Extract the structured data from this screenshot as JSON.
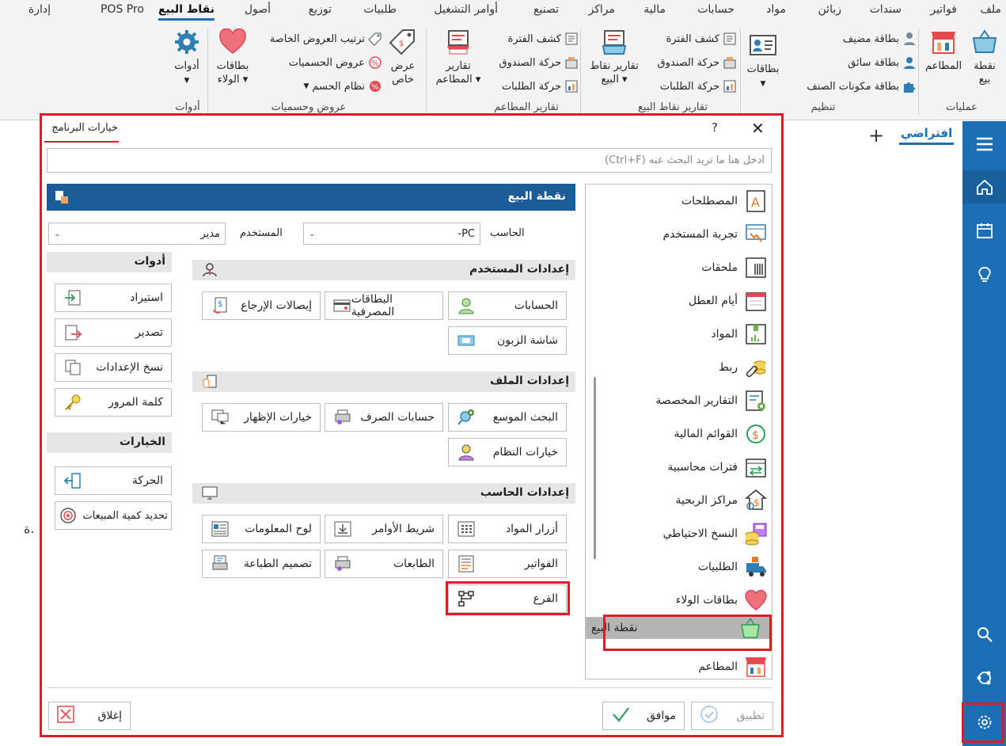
{
  "tabs": [
    "ملف",
    "فواتير",
    "سندات",
    "زبائن",
    "مواد",
    "حسابات",
    "مالية",
    "مراكز",
    "تصنيع",
    "أوامر التشغيل",
    "طلبيات",
    "توزيع",
    "أصول",
    "نقاط البيع",
    "POS Pro",
    "إدارة"
  ],
  "ribbon": {
    "ops_group": "عمليات",
    "pos_label": "نقطة بيع",
    "restaurants_label": "المطاعم",
    "org_group": "تنظيم",
    "guest_card": "بطاقة مضيف",
    "driver_card": "بطاقة سائق",
    "item_components_card": "بطاقة مكونات الصنف",
    "cards_label": "بطاقات",
    "pos_reports_group": "تقارير نقاط البيع",
    "period_statement": "كشف الفترة",
    "cash_movement": "حركة الصندوق",
    "orders_movement": "حركة الطلبات",
    "pos_reports_label": "تقارير نقاط البيع",
    "restaurant_reports_group": "تقارير المطاعم",
    "restaurant_reports_label": "تقارير المطاعم",
    "special_offers": "عرض خاص",
    "offers_group": "عروض وحسميات",
    "custom_offers_order": "ترتيب العروض الخاصة",
    "offers_discounts": "عروض الحسميات",
    "discount_system": "نظام الحسم",
    "loyalty_label": "بطاقات الولاء",
    "tools_label": "أدوات",
    "tools_group": "أدوات"
  },
  "workspace": {
    "tab": "افتراضي",
    "bg_text": "ة."
  },
  "dialog": {
    "title": "خيارات البرنامج",
    "help": "?",
    "close": "✕",
    "search_placeholder": "أدخل هنا ما تريد البحث عنه (Ctrl+F)",
    "header": "نقطة البيع",
    "computer_label": "الحاسب",
    "computer_value": "-PC",
    "user_label": "المستخدم",
    "user_value": "مدير",
    "categories": [
      "المصطلحات",
      "تجربة المستخدم",
      "ملحقات",
      "أيام العطل",
      "المواد",
      "ربط",
      "التقارير المخصصة",
      "القوائم المالية",
      "فترات محاسبية",
      "مراكز الربحية",
      "النسخ الاحتياطي",
      "الطلبيات",
      "بطاقات الولاء",
      "نقطة البيع",
      "المطاعم"
    ],
    "user_settings": {
      "title": "إعدادات المستخدم",
      "buttons": [
        "الحسابات",
        "البطاقات المصرفية",
        "إيصالات الإرجاع",
        "شاشة الزبون"
      ]
    },
    "file_settings": {
      "title": "إعدادات الملف",
      "buttons": [
        "البحث الموسع",
        "حسابات الصرف",
        "خيارات الإظهار",
        "خيارات النظام"
      ]
    },
    "computer_settings": {
      "title": "إعدادات الحاسب",
      "buttons": [
        "أزرار المواد",
        "شريط الأوامر",
        "لوح المعلومات",
        "الفواتير",
        "الطابعات",
        "تصميم الطباعة",
        "الفرع"
      ]
    },
    "tools": {
      "title": "أدوات",
      "buttons": [
        "استيراد",
        "تصدير",
        "نسخ الإعدادات",
        "كلمة المرور"
      ]
    },
    "options": {
      "title": "الخيارات",
      "buttons": [
        "الحركة",
        "تحديد كمية المبيعات"
      ]
    },
    "footer": {
      "apply": "تطبيق",
      "ok": "موافق",
      "close": "إغلاق"
    }
  },
  "colors": {
    "accent": "#1c6fb5",
    "header": "#1c5d98",
    "highlight": "#e01b24"
  }
}
